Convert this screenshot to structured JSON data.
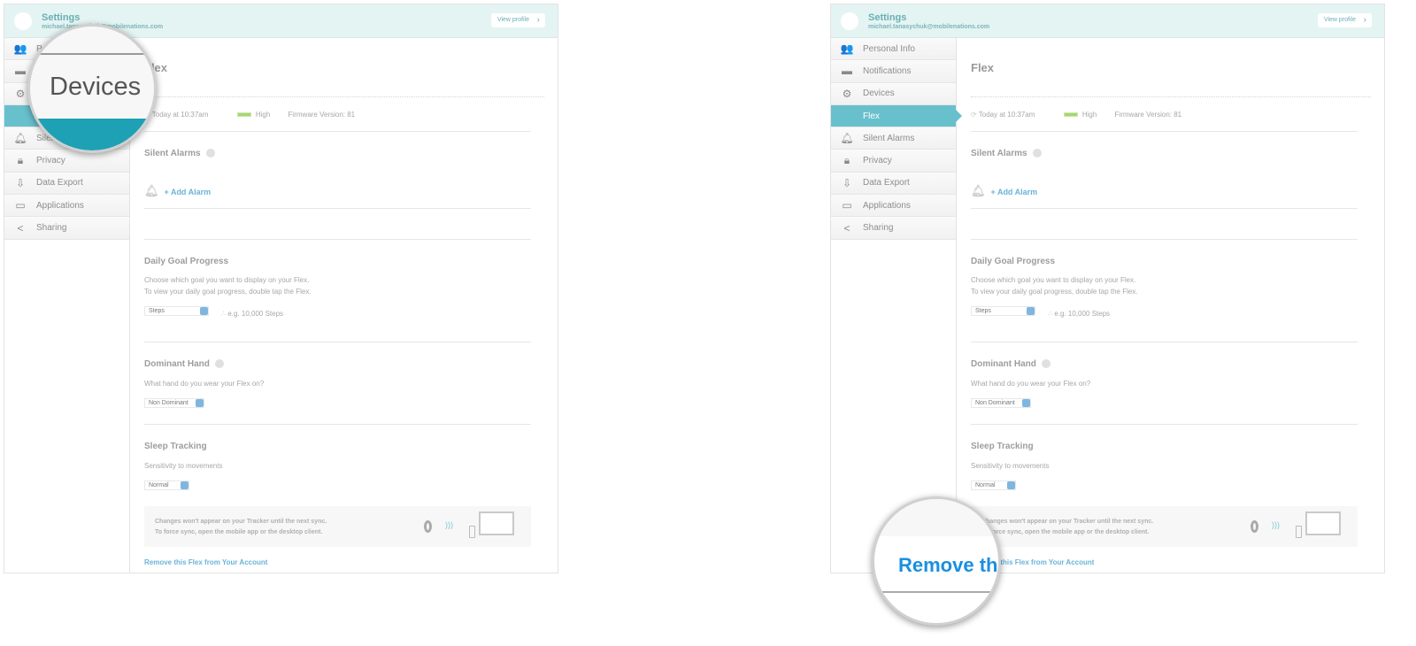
{
  "header": {
    "title": "Settings",
    "email": "michael.tanasychuk@mobilenations.com",
    "view_profile": "View profile"
  },
  "sidebar": {
    "items": [
      {
        "label": "Personal Info",
        "icon": "people-icon"
      },
      {
        "label": "Notifications",
        "icon": "speech-bubble-icon"
      },
      {
        "label": "Devices",
        "icon": "gear-icon"
      },
      {
        "label": "Flex",
        "icon": ""
      },
      {
        "label": "Silent Alarms",
        "icon": "bell-icon"
      },
      {
        "label": "Privacy",
        "icon": "lock-icon"
      },
      {
        "label": "Data Export",
        "icon": "export-icon"
      },
      {
        "label": "Applications",
        "icon": "laptop-icon"
      },
      {
        "label": "Sharing",
        "icon": "share-icon"
      }
    ]
  },
  "main": {
    "title": "Flex",
    "sync_time": "Today at 10:37am",
    "battery": "High",
    "firmware": "Firmware Version: 81",
    "silent_alarms": {
      "title": "Silent Alarms",
      "add": "+ Add Alarm"
    },
    "daily_goal": {
      "title": "Daily Goal Progress",
      "desc1": "Choose which goal you want to display on your Flex.",
      "desc2": "To view your daily goal progress, double tap the Flex.",
      "select": "Steps",
      "example": "e.g. 10,000 Steps"
    },
    "dominant_hand": {
      "title": "Dominant Hand",
      "desc": "What hand do you wear your Flex on?",
      "select": "Non Dominant"
    },
    "sleep": {
      "title": "Sleep Tracking",
      "desc": "Sensitivity to movements",
      "select": "Normal"
    },
    "sync_note": {
      "line1": "Changes won't appear on your Tracker until the next sync.",
      "line2": "To force sync, open the mobile app or the desktop client."
    },
    "remove_link": "Remove this Flex from Your Account"
  },
  "magnifier": {
    "left": "Devices",
    "right": "Remove th"
  },
  "colors": {
    "accent": "#68c0cd",
    "link": "#6ab3d9",
    "magnified_link": "#1a8fe0"
  }
}
